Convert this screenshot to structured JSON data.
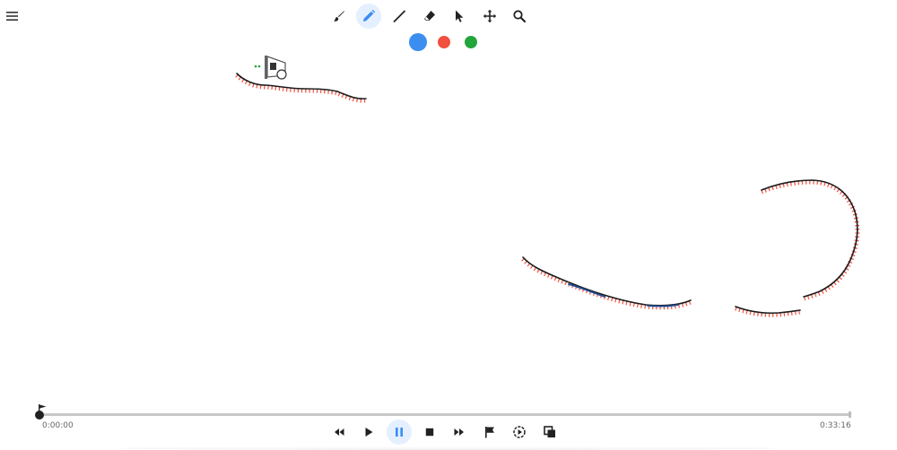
{
  "toolbar": {
    "tools": [
      {
        "name": "brush-tool",
        "icon": "brush-icon",
        "active": false
      },
      {
        "name": "pen-tool",
        "icon": "pencil-icon",
        "active": true
      },
      {
        "name": "line-tool",
        "icon": "line-icon",
        "active": false
      },
      {
        "name": "eraser-tool",
        "icon": "eraser-icon",
        "active": false
      },
      {
        "name": "select-tool",
        "icon": "cursor-arrow-icon",
        "active": false
      },
      {
        "name": "move-tool",
        "icon": "move-arrows-icon",
        "active": false
      },
      {
        "name": "zoom-tool",
        "icon": "magnifier-icon",
        "active": false
      }
    ],
    "colors": [
      "#3b8ef0",
      "#f1503f",
      "#22a63b"
    ],
    "selected_color": "#3b8ef0"
  },
  "playback": {
    "current_time": "0:00:00",
    "total_time": "0:33:16",
    "progress": 0,
    "controls": [
      {
        "name": "rewind-button",
        "icon": "rewind-icon"
      },
      {
        "name": "play-button",
        "icon": "play-icon"
      },
      {
        "name": "pause-button",
        "icon": "pause-icon",
        "active": true
      },
      {
        "name": "stop-button",
        "icon": "stop-icon"
      },
      {
        "name": "fast-forward-button",
        "icon": "fast-forward-icon"
      },
      {
        "name": "bookmark-button",
        "icon": "flag-icon"
      },
      {
        "name": "replay-button",
        "icon": "replay-icon"
      },
      {
        "name": "copy-button",
        "icon": "copy-icon"
      }
    ]
  },
  "colors": {
    "accent": "#3b8ef0",
    "stroke": "#1b1b1b",
    "stroke_hatch": "#f1503f",
    "stroke_blue": "#1f4f9a"
  }
}
